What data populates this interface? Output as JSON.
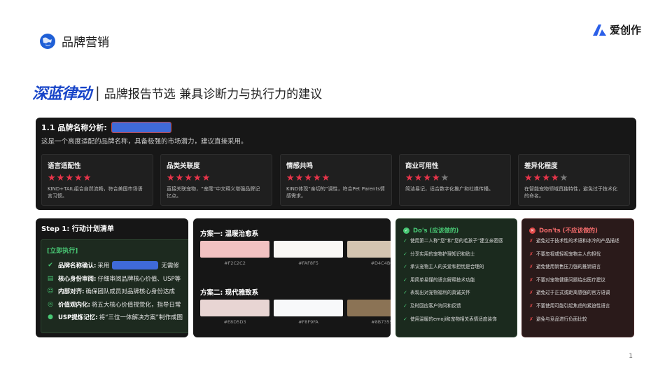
{
  "header": {
    "section_title": "品牌营销",
    "logo_text": "爱创作"
  },
  "title": {
    "brand": "深蓝律动",
    "separator": "|",
    "subtitle": "品牌报告节选 兼具诊断力与执行力的建议"
  },
  "analysis": {
    "label": "1.1 品牌名称分析:",
    "description": "这是一个高度适配的品牌名称，具备极强的市场潜力，建议直接采用。",
    "metrics": [
      {
        "title": "语言适配性",
        "rating": 5,
        "desc_lines": [
          "KIND+TAIL组合自然流畅，符合美国市场语",
          "言习惯。"
        ]
      },
      {
        "title": "品类关联度",
        "rating": 5,
        "desc_lines": [
          "直接关联宠物，“宠尾”中文释义增强品牌记",
          "忆点。"
        ]
      },
      {
        "title": "情感共鸣",
        "rating": 5,
        "desc_lines": [
          "KIND体现“亲切的”调性，符合Pet Parents情",
          "感需求。"
        ]
      },
      {
        "title": "商业可用性",
        "rating": 4,
        "desc_lines": [
          "简洁易记，适合数字化推广和社媒传播。"
        ]
      },
      {
        "title": "差异化程度",
        "rating": 4,
        "desc_lines": [
          "在智能宠物领域具独特性，避免过于技术化",
          "的命名。"
        ]
      }
    ]
  },
  "steps": {
    "title": "Step 1: 行动计划清单",
    "tag": "[立即执行]",
    "items": [
      {
        "icon": "check-circle-icon",
        "glyph": "✔",
        "label": "品牌名称确认:",
        "text": "采用",
        "after": "无需修"
      },
      {
        "icon": "clipboard-icon",
        "glyph": "▤",
        "label": "核心身份审阅:",
        "text": "仔细审阅品牌核心价值、USP等",
        "after": ""
      },
      {
        "icon": "people-icon",
        "glyph": "☺",
        "label": "内部对齐:",
        "text": "确保团队成员对品牌核心身份达成",
        "after": ""
      },
      {
        "icon": "target-icon",
        "glyph": "◎",
        "label": "价值观内化:",
        "text": "将五大核心价值视觉化，指导日常",
        "after": ""
      },
      {
        "icon": "bulb-icon",
        "glyph": "●",
        "label": "USP提炼记忆:",
        "text": "将“三位一体解决方案”制作成图",
        "after": ""
      }
    ]
  },
  "schemes": [
    {
      "title": "方案一: 温暖治愈系",
      "colors": [
        "#F2C2C2",
        "#FAF8F5",
        "#D4C4B0"
      ]
    },
    {
      "title": "方案二: 现代雅致系",
      "colors": [
        "#E8D5D3",
        "#F8F9FA",
        "#8B7355"
      ]
    }
  ],
  "dos": {
    "title": "Do's (应该做的)",
    "items": [
      "使用第二人称“您”和“您的毛孩子”建立亲密感",
      "分享实用的宠物护理知识和贴士",
      "承认宠物主人的关爱和担忧是合理的",
      "用简单易懂的语言解释技术功能",
      "表现出对宠物福利的真诚关怀",
      "及时回应客户询问和反馈",
      "使用温暖的emoji和宠物相关表情适度装饰"
    ]
  },
  "donts": {
    "title": "Don'ts (不应该做的)",
    "items": [
      "避免过于技术性的术语和冰冷的产品描述",
      "不要忽视或轻视宠物主人的担忧",
      "避免使用销售压力强的推销语言",
      "不要对宠物健康问题给出医疗建议",
      "避免过于正式或距离感强的官方语调",
      "不要使用可能引起焦虑的紧迫性语言",
      "避免与竞品进行负面比较"
    ]
  },
  "page_number": "1",
  "colors": {
    "brand_blue": "#1744c8",
    "star_red": "#e8344a",
    "do_green": "#48c774",
    "dont_red": "#e24a4a"
  }
}
